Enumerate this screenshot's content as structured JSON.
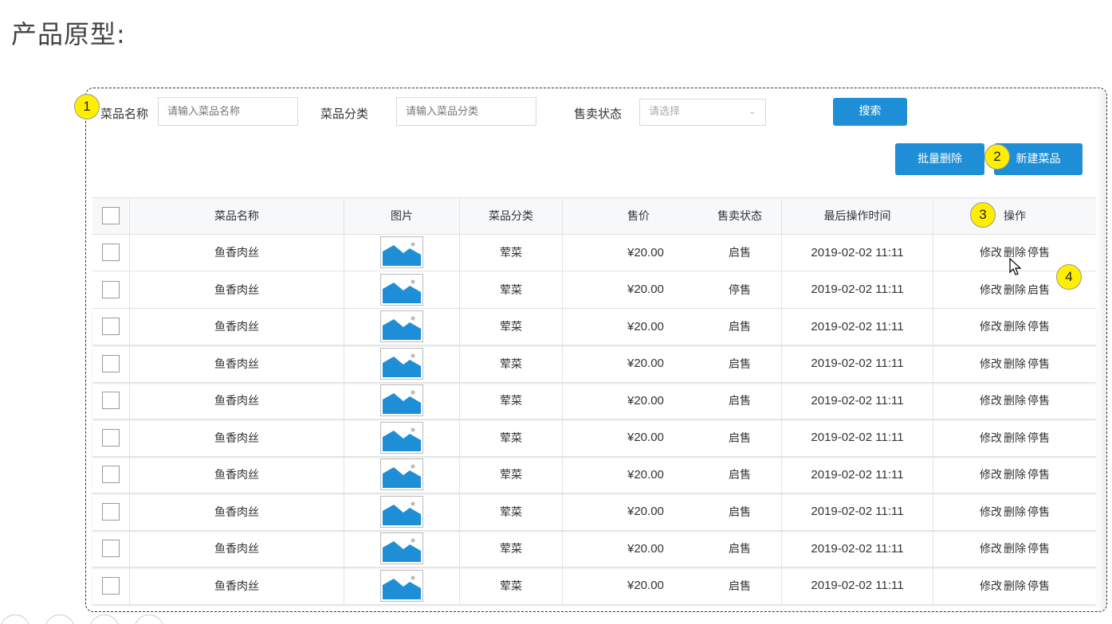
{
  "page_title": "产品原型:",
  "filters": {
    "name_label": "菜品名称",
    "name_placeholder": "请输入菜品名称",
    "category_label": "菜品分类",
    "category_placeholder": "请输入菜品分类",
    "status_label": "售卖状态",
    "status_placeholder": "请选择",
    "search_button": "搜索"
  },
  "actions": {
    "batch_delete": "批量删除",
    "new_dish": "新建菜品"
  },
  "markers": [
    "1",
    "2",
    "3",
    "4"
  ],
  "table": {
    "headers": {
      "name": "菜品名称",
      "image": "图片",
      "category": "菜品分类",
      "price": "售价",
      "status": "售卖状态",
      "updated": "最后操作时间",
      "ops": "操作"
    },
    "rows": [
      {
        "name": "鱼香肉丝",
        "category": "荤菜",
        "price": "¥20.00",
        "status": "启售",
        "updated": "2019-02-02 11:11",
        "op_edit": "修改",
        "op_delete": "删除",
        "op_toggle": "停售"
      },
      {
        "name": "鱼香肉丝",
        "category": "荤菜",
        "price": "¥20.00",
        "status": "停售",
        "updated": "2019-02-02 11:11",
        "op_edit": "修改",
        "op_delete": "删除",
        "op_toggle": "启售"
      },
      {
        "name": "鱼香肉丝",
        "category": "荤菜",
        "price": "¥20.00",
        "status": "启售",
        "updated": "2019-02-02 11:11",
        "op_edit": "修改",
        "op_delete": "删除",
        "op_toggle": "停售"
      },
      {
        "name": "鱼香肉丝",
        "category": "荤菜",
        "price": "¥20.00",
        "status": "启售",
        "updated": "2019-02-02 11:11",
        "op_edit": "修改",
        "op_delete": "删除",
        "op_toggle": "停售"
      },
      {
        "name": "鱼香肉丝",
        "category": "荤菜",
        "price": "¥20.00",
        "status": "启售",
        "updated": "2019-02-02 11:11",
        "op_edit": "修改",
        "op_delete": "删除",
        "op_toggle": "停售"
      },
      {
        "name": "鱼香肉丝",
        "category": "荤菜",
        "price": "¥20.00",
        "status": "启售",
        "updated": "2019-02-02 11:11",
        "op_edit": "修改",
        "op_delete": "删除",
        "op_toggle": "停售"
      },
      {
        "name": "鱼香肉丝",
        "category": "荤菜",
        "price": "¥20.00",
        "status": "启售",
        "updated": "2019-02-02 11:11",
        "op_edit": "修改",
        "op_delete": "删除",
        "op_toggle": "停售"
      },
      {
        "name": "鱼香肉丝",
        "category": "荤菜",
        "price": "¥20.00",
        "status": "启售",
        "updated": "2019-02-02 11:11",
        "op_edit": "修改",
        "op_delete": "删除",
        "op_toggle": "停售"
      },
      {
        "name": "鱼香肉丝",
        "category": "荤菜",
        "price": "¥20.00",
        "status": "启售",
        "updated": "2019-02-02 11:11",
        "op_edit": "修改",
        "op_delete": "删除",
        "op_toggle": "停售"
      },
      {
        "name": "鱼香肉丝",
        "category": "荤菜",
        "price": "¥20.00",
        "status": "启售",
        "updated": "2019-02-02 11:11",
        "op_edit": "修改",
        "op_delete": "删除",
        "op_toggle": "停售"
      }
    ]
  },
  "colors": {
    "primary": "#1e8fd7",
    "marker": "#ffee00",
    "image_placeholder": "#1e8fd7"
  }
}
